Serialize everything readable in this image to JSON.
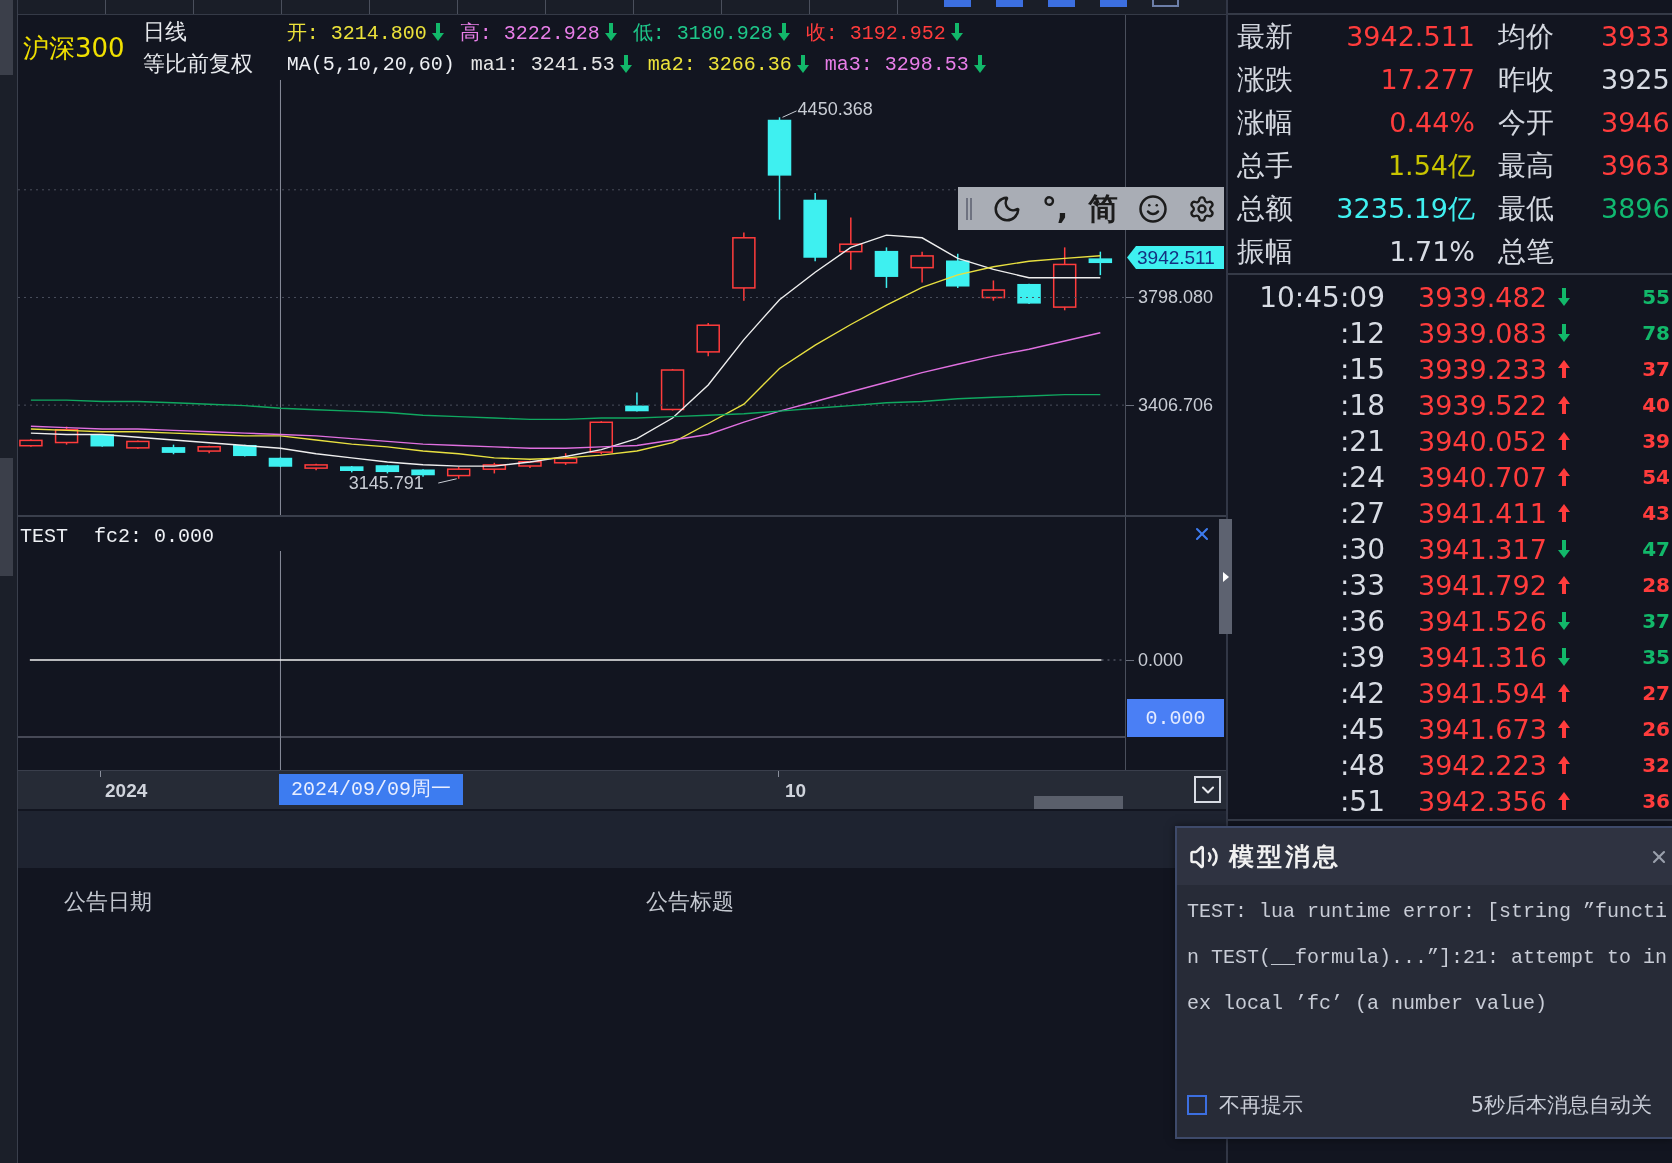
{
  "chart_header": {
    "symbol": "沪深300",
    "period": "日线",
    "adjustment": "等比前复权",
    "prices": [
      {
        "text": "开: 3214.800",
        "color": "#ece23a",
        "rising": false
      },
      {
        "text": "高: 3222.928",
        "color": "#e87ee8",
        "rising": false
      },
      {
        "text": "低: 3180.928",
        "color": "#1ec88a",
        "rising": false
      },
      {
        "text": "收: 3192.952",
        "color": "#ff3c3c",
        "rising": false
      }
    ],
    "ma_label": "MA(5,10,20,60)",
    "ma_values": [
      {
        "text": "ma1: 3241.53",
        "color": "#e6e6e6",
        "rising": false
      },
      {
        "text": "ma2: 3266.36",
        "color": "#ece23a",
        "rising": false
      },
      {
        "text": "ma3: 3298.53",
        "color": "#e87ee8",
        "rising": false
      }
    ]
  },
  "main_chart": {
    "high_label": "4450.368",
    "low_label": "3145.791",
    "last_price": "3942.511",
    "chart_data": {
      "type": "line",
      "ylim": [
        3000,
        4825
      ],
      "yticks": [
        {
          "value": 3798.08,
          "label": "3798.080"
        },
        {
          "value": 3406.706,
          "label": "3406.706"
        }
      ],
      "series": [
        {
          "color": "#eeeeee",
          "values": [
            3305,
            3300,
            3300,
            3290,
            3280,
            3270,
            3260,
            3250,
            3230,
            3215,
            3200,
            3190,
            3185,
            3185,
            3200,
            3220,
            3245,
            3285,
            3360,
            3480,
            3645,
            3790,
            3890,
            3980,
            4025,
            4015,
            3940,
            3900,
            3870,
            3870,
            3870
          ]
        },
        {
          "color": "#e8e040",
          "values": [
            3320,
            3315,
            3310,
            3310,
            3305,
            3300,
            3295,
            3295,
            3280,
            3265,
            3255,
            3240,
            3230,
            3215,
            3210,
            3215,
            3225,
            3240,
            3270,
            3340,
            3410,
            3540,
            3625,
            3700,
            3770,
            3835,
            3880,
            3910,
            3930,
            3940,
            3950
          ]
        },
        {
          "color": "#e070e0",
          "values": [
            3330,
            3325,
            3320,
            3320,
            3315,
            3310,
            3305,
            3300,
            3295,
            3285,
            3275,
            3265,
            3260,
            3255,
            3250,
            3250,
            3255,
            3260,
            3280,
            3300,
            3345,
            3385,
            3420,
            3455,
            3490,
            3525,
            3555,
            3585,
            3610,
            3640,
            3670
          ]
        },
        {
          "color": "#10a860",
          "values": [
            3425,
            3425,
            3420,
            3420,
            3415,
            3410,
            3405,
            3395,
            3390,
            3385,
            3380,
            3370,
            3365,
            3360,
            3355,
            3355,
            3360,
            3360,
            3365,
            3370,
            3375,
            3385,
            3395,
            3405,
            3415,
            3420,
            3430,
            3435,
            3440,
            3445,
            3445
          ]
        }
      ]
    }
  },
  "ime_toolbar": {
    "punctuation": "°,",
    "mode": "简"
  },
  "indicator": {
    "name": "TEST",
    "value": "fc2: 0.000",
    "axis_label": "0.000",
    "last_value": "0.000"
  },
  "time_axis": {
    "labels": [
      "2024",
      "10"
    ],
    "cursor_date": "2024/09/09周一"
  },
  "announcements": {
    "columns": [
      "公告日期",
      "公告标题"
    ]
  },
  "quote": {
    "rows": [
      {
        "left": {
          "label": "最新",
          "value": "3942.511",
          "color": "#ff3c3c"
        },
        "right": {
          "label": "均价",
          "value": "3933",
          "color": "#ff3c3c"
        }
      },
      {
        "left": {
          "label": "涨跌",
          "value": "17.277",
          "color": "#ff3c3c"
        },
        "right": {
          "label": "昨收",
          "value": "3925",
          "color": "#d8dce4"
        }
      },
      {
        "left": {
          "label": "涨幅",
          "value": "0.44%",
          "color": "#ff3c3c"
        },
        "right": {
          "label": "今开",
          "value": "3946",
          "color": "#ff3c3c"
        }
      },
      {
        "left": {
          "label": "总手",
          "value": "1.54亿",
          "color": "#c8c400"
        },
        "right": {
          "label": "最高",
          "value": "3963",
          "color": "#ff3c3c"
        }
      },
      {
        "left": {
          "label": "总额",
          "value": "3235.19亿",
          "color": "#40f0f0"
        },
        "right": {
          "label": "最低",
          "value": "3896",
          "color": "#10b870"
        }
      },
      {
        "left": {
          "label": "振幅",
          "value": "1.71%",
          "color": "#d8dce4"
        },
        "right": {
          "label": "总笔"
        }
      }
    ]
  },
  "ticks": [
    {
      "time": "10:45:09",
      "price": "3939.482",
      "rising": false,
      "volume": "55"
    },
    {
      "time": ":12",
      "price": "3939.083",
      "rising": false,
      "volume": "78"
    },
    {
      "time": ":15",
      "price": "3939.233",
      "rising": true,
      "volume": "37"
    },
    {
      "time": ":18",
      "price": "3939.522",
      "rising": true,
      "volume": "40"
    },
    {
      "time": ":21",
      "price": "3940.052",
      "rising": true,
      "volume": "39"
    },
    {
      "time": ":24",
      "price": "3940.707",
      "rising": true,
      "volume": "54"
    },
    {
      "time": ":27",
      "price": "3941.411",
      "rising": true,
      "volume": "43"
    },
    {
      "time": ":30",
      "price": "3941.317",
      "rising": false,
      "volume": "47"
    },
    {
      "time": ":33",
      "price": "3941.792",
      "rising": true,
      "volume": "28"
    },
    {
      "time": ":36",
      "price": "3941.526",
      "rising": false,
      "volume": "37"
    },
    {
      "time": ":39",
      "price": "3941.316",
      "rising": false,
      "volume": "35"
    },
    {
      "time": ":42",
      "price": "3941.594",
      "rising": true,
      "volume": "27"
    },
    {
      "time": ":45",
      "price": "3941.673",
      "rising": true,
      "volume": "26"
    },
    {
      "time": ":48",
      "price": "3942.223",
      "rising": true,
      "volume": "32"
    },
    {
      "time": ":51",
      "price": "3942.356",
      "rising": true,
      "volume": "36"
    }
  ],
  "message_dialog": {
    "title": "模型消息",
    "lines": [
      "TEST: lua runtime error: [string ”functi",
      "n TEST(__formula)...”]:21: attempt to in",
      "ex local ’fc’ (a number value)"
    ],
    "dont_show_again": {
      "label": "不再提示",
      "checked": false
    },
    "auto_close": "5秒后本消息自动关"
  }
}
